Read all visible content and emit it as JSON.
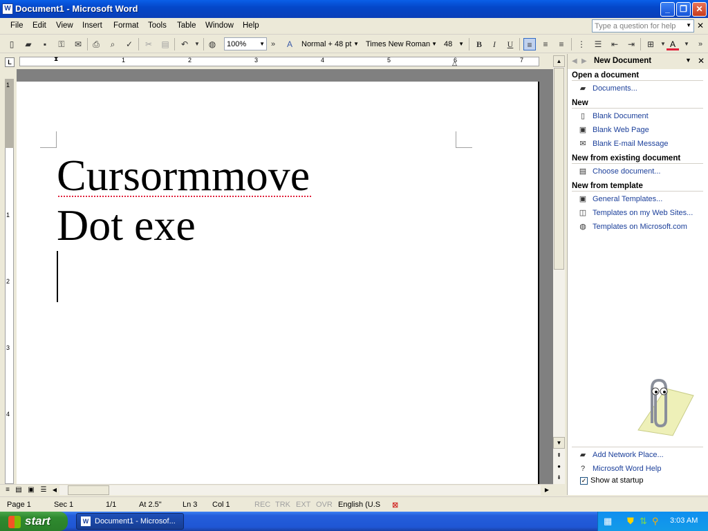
{
  "window": {
    "title": "Document1 - Microsoft Word",
    "app_icon": "W",
    "minimize": "_",
    "restore": "❐",
    "close": "✕"
  },
  "menu": {
    "items": [
      "File",
      "Edit",
      "View",
      "Insert",
      "Format",
      "Tools",
      "Table",
      "Window",
      "Help"
    ],
    "help_placeholder": "Type a question for help",
    "doc_close": "✕"
  },
  "toolbar": {
    "zoom": "100%",
    "style": "Normal + 48 pt",
    "font": "Times New Roman",
    "size": "48",
    "bold": "B",
    "italic": "I",
    "underline": "U",
    "more": "»"
  },
  "ruler": {
    "tab_selector": "L",
    "marks": [
      "1",
      "2",
      "3",
      "4",
      "5",
      "6",
      "7"
    ],
    "vmarks": [
      "1",
      "1",
      "2",
      "3",
      "4"
    ]
  },
  "document": {
    "line1": "Cursormmove",
    "line2": "Dot exe"
  },
  "taskpane": {
    "title": "New Document",
    "sections": {
      "open": "Open a document",
      "new": "New",
      "existing": "New from existing document",
      "template": "New from template"
    },
    "links": {
      "documents": "Documents...",
      "blank_doc": "Blank Document",
      "blank_web": "Blank Web Page",
      "blank_email": "Blank E-mail Message",
      "choose_doc": "Choose document...",
      "general_templates": "General Templates...",
      "templates_web": "Templates on my Web Sites...",
      "templates_ms": "Templates on Microsoft.com",
      "add_network": "Add Network Place...",
      "word_help": "Microsoft Word Help"
    },
    "show_at_startup": "Show at startup",
    "show_at_startup_checked": true
  },
  "status": {
    "page": "Page 1",
    "sec": "Sec 1",
    "pages": "1/1",
    "at": "At 2.5\"",
    "ln": "Ln 3",
    "col": "Col 1",
    "rec": "REC",
    "trk": "TRK",
    "ext": "EXT",
    "ovr": "OVR",
    "lang": "English (U.S"
  },
  "taskbar": {
    "start": "start",
    "item": "Document1 - Microsof...",
    "clock": "3:03 AM"
  },
  "colors": {
    "title_blue": "#0447c9",
    "link_blue": "#1b3f9a",
    "start_green": "#2f8a2f",
    "spell_red": "#e0203a"
  }
}
